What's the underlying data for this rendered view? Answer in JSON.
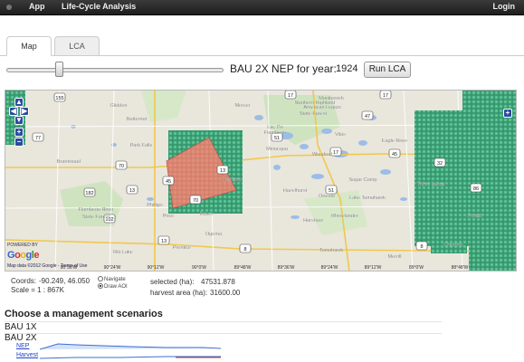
{
  "navbar": {
    "app_label": "App",
    "lca_label": "Life-Cycle Analysis",
    "login_label": "Login"
  },
  "tabs": [
    {
      "label": "Map",
      "active": true
    },
    {
      "label": "LCA",
      "active": false
    }
  ],
  "controls": {
    "year_label": "BAU 2X NEP for year:",
    "year_value": "1924",
    "slider_fraction": 0.25,
    "run_button": "Run LCA"
  },
  "map": {
    "place_labels": [
      "Butternut",
      "Park Falls",
      "Phillips",
      "Price",
      "Dover",
      "Prentice",
      "Flambeau River",
      "State Forest",
      "Glidden",
      "Mercer",
      "Manitowish",
      "Northern Highland",
      "American Legion",
      "State Forest",
      "Vilas",
      "Lac Du",
      "Flambeau",
      "Minocqua",
      "Woodruff",
      "Eagle River",
      "Sugar Camp",
      "Three Lakes",
      "Oneida",
      "Rhinelander",
      "Harshaw",
      "Tomahawk",
      "Merrill",
      "Crandon",
      "Forest",
      "Harrison",
      "Hazelhurst",
      "Lake Tomahawk",
      "Brantwood",
      "Ogema",
      "Rib Lake"
    ],
    "route_shields": [
      "77",
      "13",
      "70",
      "13",
      "182",
      "70",
      "47",
      "51",
      "17",
      "45",
      "32",
      "8",
      "8",
      "13",
      "102",
      "86",
      "51",
      "45",
      "17",
      "17",
      "155"
    ],
    "lon_ticks": [
      "90°36'W",
      "90°24'W",
      "90°12'W",
      "90°0'W",
      "89°48'W",
      "89°36'W",
      "89°24'W",
      "89°12'W",
      "89°0'W",
      "88°48'W"
    ],
    "google": "Google",
    "powered_by": "POWERED BY",
    "terms": "Map data ©2012 Google - Terms of Use",
    "colors": {
      "forest_green": "#3aa27a",
      "water": "#9bbde6",
      "land": "#e9e6dc",
      "selection": "#e8776c"
    }
  },
  "info": {
    "coords_label": "Coords:",
    "coords_value": "-90.249, 46.050",
    "scale_label": "Scale = 1 : 867K",
    "navigate_label": "Navigate",
    "draw_aoi_label": "Draw AOI",
    "selected_label": "selected (ha):",
    "selected_value": "47531.878",
    "harvest_label": "harvest area (ha):",
    "harvest_value": "31600.00"
  },
  "scenarios": {
    "title": "Choose a management scenarios",
    "items": [
      {
        "name": "BAU 1X"
      },
      {
        "name": "BAU 2X",
        "series": [
          "NEP",
          "Harvest"
        ]
      }
    ]
  }
}
